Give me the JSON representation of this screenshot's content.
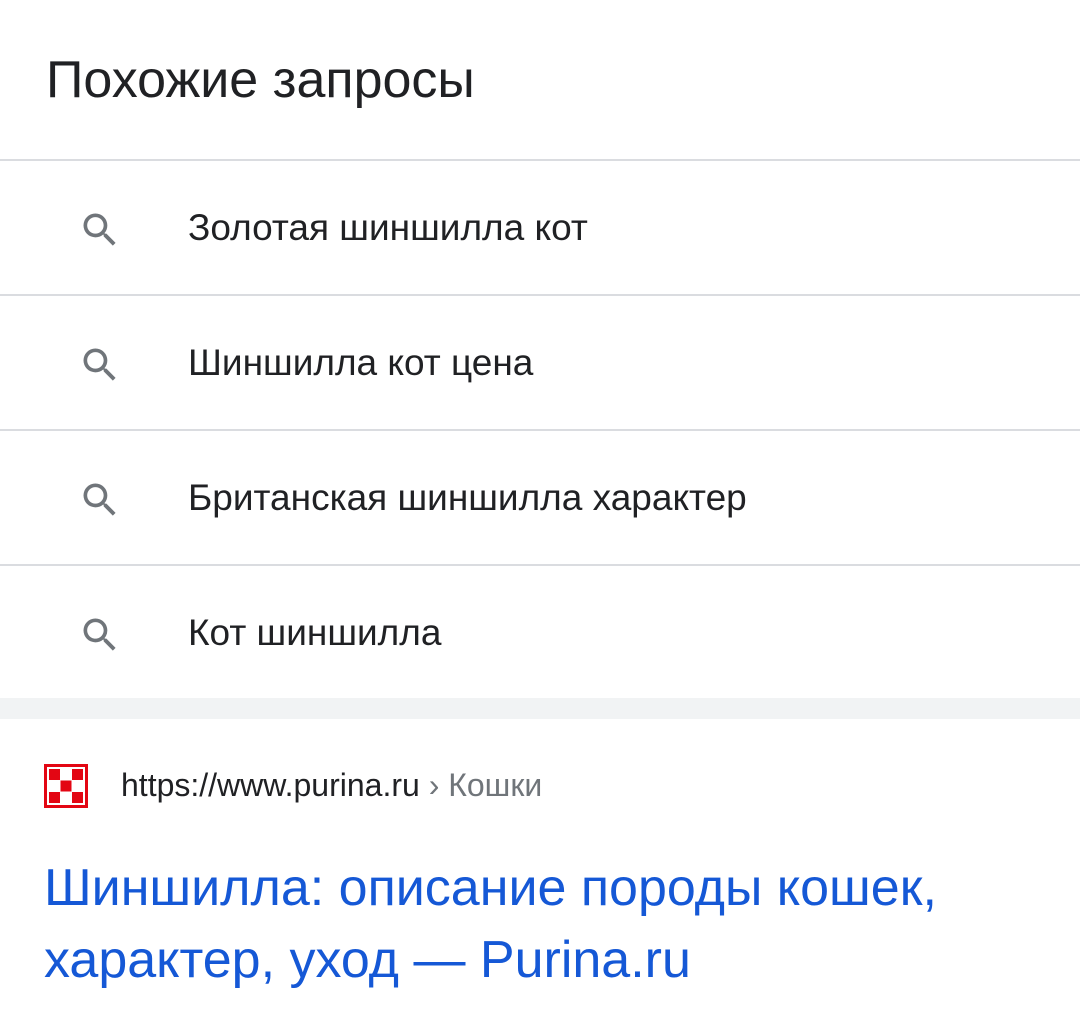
{
  "related_searches": {
    "title": "Похожие запросы",
    "items": [
      {
        "label": "Золотая шиншилла кот",
        "icon": "search-icon"
      },
      {
        "label": "Шиншилла кот цена",
        "icon": "search-icon"
      },
      {
        "label": "Британская шиншилла характер",
        "icon": "search-icon"
      },
      {
        "label": "Кот шиншилла",
        "icon": "search-icon"
      }
    ]
  },
  "result": {
    "favicon": "purina-favicon",
    "url_domain": "https://www.purina.ru",
    "url_separator": "›",
    "url_breadcrumb": "Кошки",
    "title": "Шиншилла: описание породы кошек, характер, уход — Purina.ru"
  },
  "colors": {
    "link": "#1558d6",
    "divider": "#dadce0",
    "band": "#f1f3f4",
    "icon": "#70757a",
    "favicon_red": "#e30613"
  }
}
